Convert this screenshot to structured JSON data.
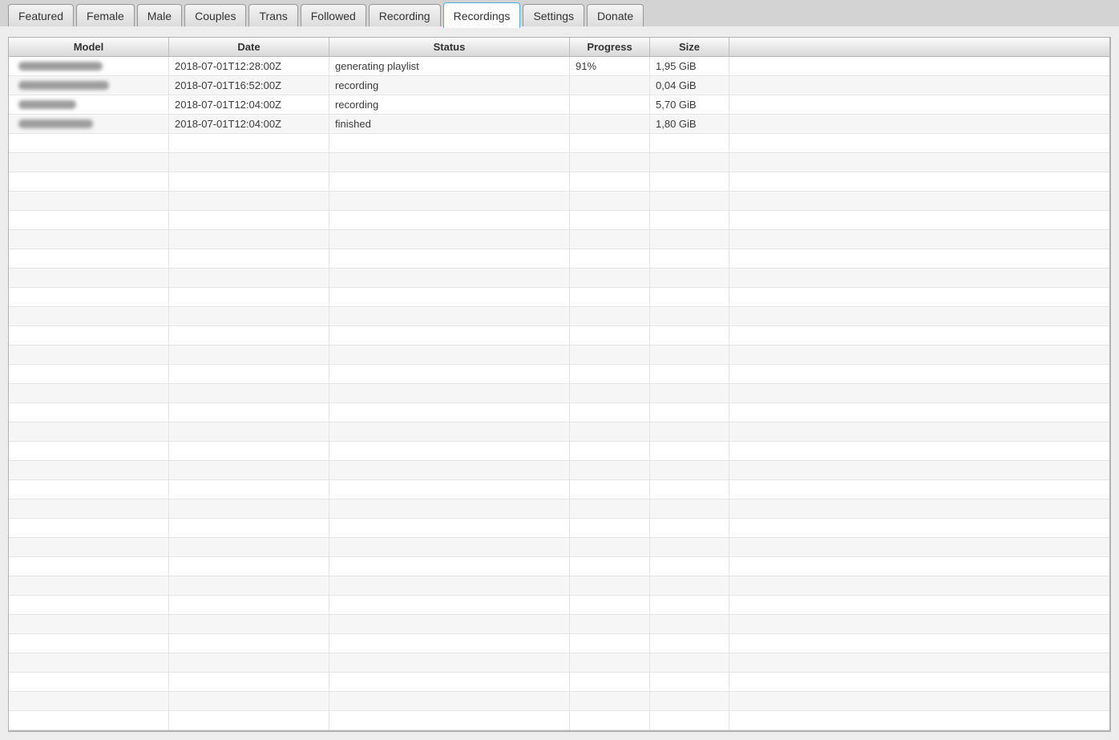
{
  "tab_bar": {
    "tabs": [
      {
        "label": "Featured",
        "active": false
      },
      {
        "label": "Female",
        "active": false
      },
      {
        "label": "Male",
        "active": false
      },
      {
        "label": "Couples",
        "active": false
      },
      {
        "label": "Trans",
        "active": false
      },
      {
        "label": "Followed",
        "active": false
      },
      {
        "label": "Recording",
        "active": false
      },
      {
        "label": "Recordings",
        "active": true
      },
      {
        "label": "Settings",
        "active": false
      },
      {
        "label": "Donate",
        "active": false
      }
    ]
  },
  "table": {
    "columns": [
      {
        "label": "Model"
      },
      {
        "label": "Date"
      },
      {
        "label": "Status"
      },
      {
        "label": "Progress"
      },
      {
        "label": "Size"
      },
      {
        "label": ""
      }
    ],
    "rows": [
      {
        "model_redacted": true,
        "model_blur_width": 105,
        "date": "2018-07-01T12:28:00Z",
        "status": "generating playlist",
        "progress": "91%",
        "size": "1,95 GiB"
      },
      {
        "model_redacted": true,
        "model_blur_width": 113,
        "date": "2018-07-01T16:52:00Z",
        "status": "recording",
        "progress": "",
        "size": "0,04 GiB"
      },
      {
        "model_redacted": true,
        "model_blur_width": 72,
        "date": "2018-07-01T12:04:00Z",
        "status": "recording",
        "progress": "",
        "size": "5,70 GiB"
      },
      {
        "model_redacted": true,
        "model_blur_width": 93,
        "date": "2018-07-01T12:04:00Z",
        "status": "finished",
        "progress": "",
        "size": "1,80 GiB"
      }
    ],
    "empty_row_count": 31
  },
  "colors": {
    "active_tab_border": "#57aed8"
  }
}
